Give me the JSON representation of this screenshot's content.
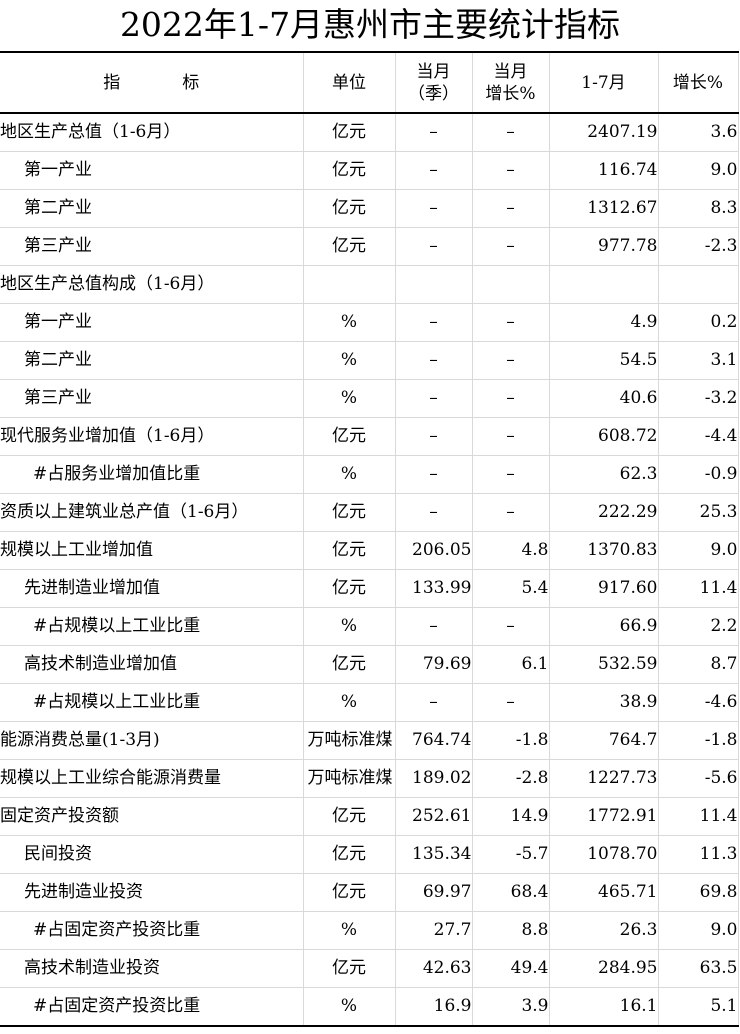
{
  "title": "2022年1-7月惠州市主要统计指标",
  "headers": {
    "indicator_left": "指",
    "indicator_right": "标",
    "unit": "单位",
    "month_line1": "当月",
    "month_line2": "（季）",
    "month_growth_line1": "当月",
    "month_growth_line2": "增长%",
    "ytd": "1-7月",
    "growth": "增长%"
  },
  "rows": [
    {
      "name": "地区生产总值（1-6月）",
      "indent": 0,
      "unit": "亿元",
      "month": "–",
      "month_growth": "–",
      "ytd": "2407.19",
      "growth": "3.6"
    },
    {
      "name": "第一产业",
      "indent": 1,
      "unit": "亿元",
      "month": "–",
      "month_growth": "–",
      "ytd": "116.74",
      "growth": "9.0"
    },
    {
      "name": "第二产业",
      "indent": 1,
      "unit": "亿元",
      "month": "–",
      "month_growth": "–",
      "ytd": "1312.67",
      "growth": "8.3"
    },
    {
      "name": "第三产业",
      "indent": 1,
      "unit": "亿元",
      "month": "–",
      "month_growth": "–",
      "ytd": "977.78",
      "growth": "-2.3"
    },
    {
      "name": "地区生产总值构成（1-6月）",
      "indent": 0,
      "unit": "",
      "month": "",
      "month_growth": "",
      "ytd": "",
      "growth": ""
    },
    {
      "name": "第一产业",
      "indent": 1,
      "unit": "%",
      "month": "–",
      "month_growth": "–",
      "ytd": "4.9",
      "growth": "0.2"
    },
    {
      "name": "第二产业",
      "indent": 1,
      "unit": "%",
      "month": "–",
      "month_growth": "–",
      "ytd": "54.5",
      "growth": "3.1"
    },
    {
      "name": "第三产业",
      "indent": 1,
      "unit": "%",
      "month": "–",
      "month_growth": "–",
      "ytd": "40.6",
      "growth": "-3.2"
    },
    {
      "name": "现代服务业增加值（1-6月）",
      "indent": 0,
      "unit": "亿元",
      "month": "–",
      "month_growth": "–",
      "ytd": "608.72",
      "growth": "-4.4"
    },
    {
      "name": "#占服务业增加值比重",
      "indent": 2,
      "unit": "%",
      "month": "–",
      "month_growth": "–",
      "ytd": "62.3",
      "growth": "-0.9"
    },
    {
      "name": "资质以上建筑业总产值（1-6月）",
      "indent": 0,
      "unit": "亿元",
      "month": "–",
      "month_growth": "–",
      "ytd": "222.29",
      "growth": "25.3"
    },
    {
      "name": "规模以上工业增加值",
      "indent": 0,
      "unit": "亿元",
      "month": "206.05",
      "month_growth": "4.8",
      "ytd": "1370.83",
      "growth": "9.0"
    },
    {
      "name": "先进制造业增加值",
      "indent": 1,
      "unit": "亿元",
      "month": "133.99",
      "month_growth": "5.4",
      "ytd": "917.60",
      "growth": "11.4"
    },
    {
      "name": "#占规模以上工业比重",
      "indent": 2,
      "unit": "%",
      "month": "–",
      "month_growth": "–",
      "ytd": "66.9",
      "growth": "2.2"
    },
    {
      "name": "高技术制造业增加值",
      "indent": 1,
      "unit": "亿元",
      "month": "79.69",
      "month_growth": "6.1",
      "ytd": "532.59",
      "growth": "8.7"
    },
    {
      "name": "#占规模以上工业比重",
      "indent": 2,
      "unit": "%",
      "month": "–",
      "month_growth": "–",
      "ytd": "38.9",
      "growth": "-4.6"
    },
    {
      "name": "能源消费总量(1-3月)",
      "indent": 0,
      "unit": "万吨标准煤",
      "month": "764.74",
      "month_growth": "-1.8",
      "ytd": "764.7",
      "growth": "-1.8"
    },
    {
      "name": "规模以上工业综合能源消费量",
      "indent": 0,
      "unit": "万吨标准煤",
      "month": "189.02",
      "month_growth": "-2.8",
      "ytd": "1227.73",
      "growth": "-5.6"
    },
    {
      "name": "固定资产投资额",
      "indent": 0,
      "unit": "亿元",
      "month": "252.61",
      "month_growth": "14.9",
      "ytd": "1772.91",
      "growth": "11.4"
    },
    {
      "name": "民间投资",
      "indent": 1,
      "unit": "亿元",
      "month": "135.34",
      "month_growth": "-5.7",
      "ytd": "1078.70",
      "growth": "11.3"
    },
    {
      "name": "先进制造业投资",
      "indent": 1,
      "unit": "亿元",
      "month": "69.97",
      "month_growth": "68.4",
      "ytd": "465.71",
      "growth": "69.8"
    },
    {
      "name": "#占固定资产投资比重",
      "indent": 2,
      "unit": "%",
      "month": "27.7",
      "month_growth": "8.8",
      "ytd": "26.3",
      "growth": "9.0"
    },
    {
      "name": "高技术制造业投资",
      "indent": 1,
      "unit": "亿元",
      "month": "42.63",
      "month_growth": "49.4",
      "ytd": "284.95",
      "growth": "63.5"
    },
    {
      "name": "#占固定资产投资比重",
      "indent": 2,
      "unit": "%",
      "month": "16.9",
      "month_growth": "3.9",
      "ytd": "16.1",
      "growth": "5.1"
    }
  ]
}
